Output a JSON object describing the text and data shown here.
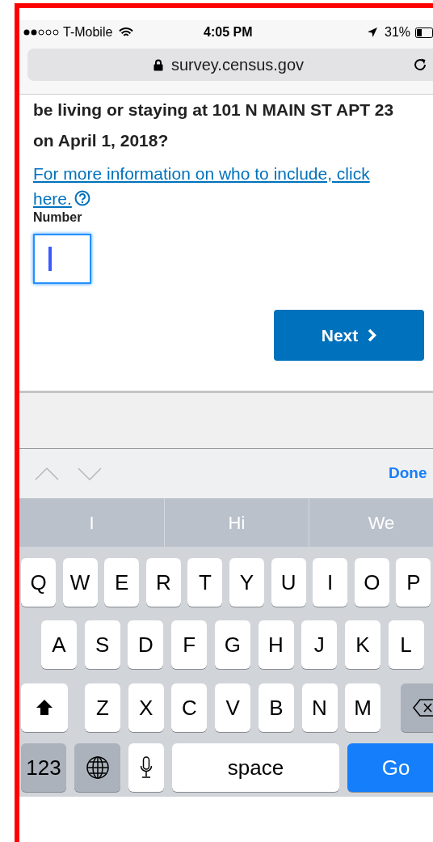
{
  "status_bar": {
    "carrier": "T-Mobile",
    "time": "4:05 PM",
    "battery": "31%"
  },
  "address_bar": {
    "url": "survey.census.gov"
  },
  "question": {
    "text": "be living or staying at 101 N MAIN ST APT 23 on April 1, 2018?"
  },
  "help_link": {
    "text": "For more information on who to include, click here."
  },
  "number_field": {
    "label": "Number",
    "focused": true
  },
  "next_button": {
    "label": "Next"
  },
  "keyboard_toolbar": {
    "done": "Done"
  },
  "suggestions": [
    "I",
    "Hi",
    "We"
  ],
  "keyboard": {
    "rows": [
      [
        "Q",
        "W",
        "E",
        "R",
        "T",
        "Y",
        "U",
        "I",
        "O",
        "P"
      ],
      [
        "A",
        "S",
        "D",
        "F",
        "G",
        "H",
        "J",
        "K",
        "L"
      ],
      [
        "Z",
        "X",
        "C",
        "V",
        "B",
        "N",
        "M"
      ]
    ],
    "numbers_key": "123",
    "space_key": "space",
    "return_key": "Go"
  }
}
